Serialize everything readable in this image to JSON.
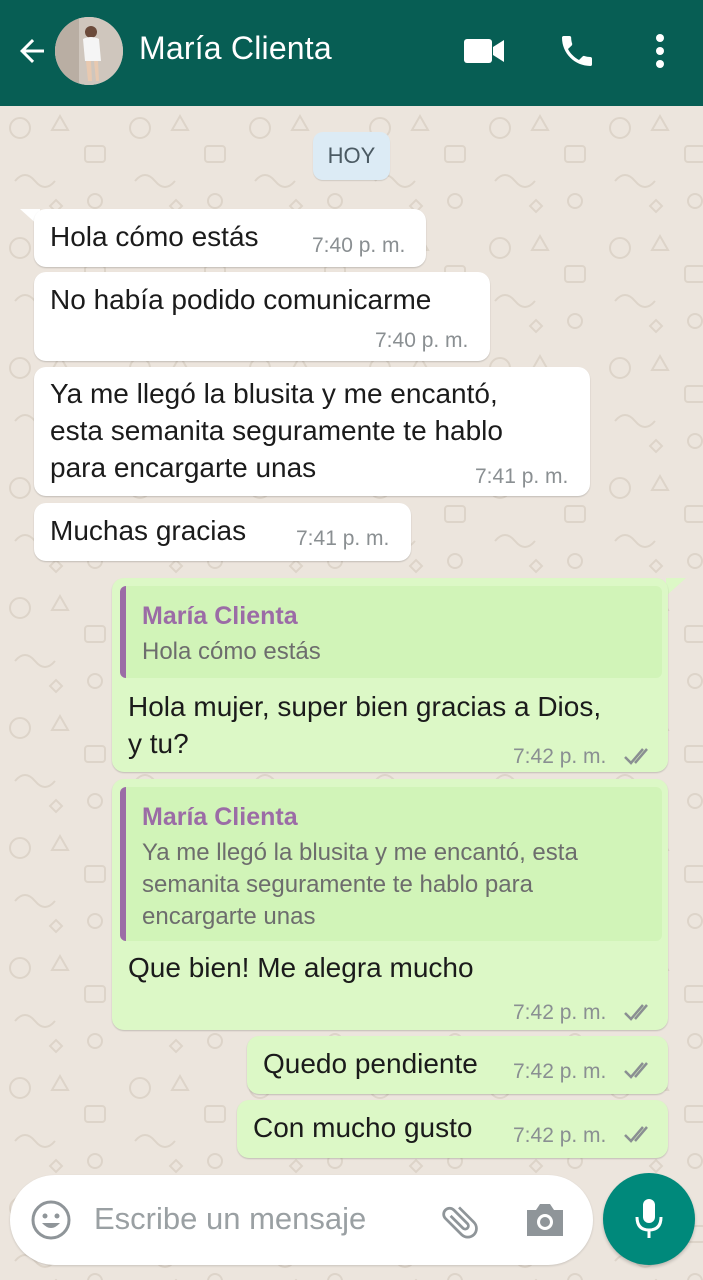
{
  "header": {
    "contact_name": "María Clienta",
    "back_icon": "arrow-left-icon",
    "video_icon": "video-call-icon",
    "phone_icon": "voice-call-icon",
    "menu_icon": "more-vert-icon",
    "background_color": "#075e54"
  },
  "chat": {
    "date_label": "HOY",
    "messages": [
      {
        "direction": "in",
        "text": "Hola cómo estás",
        "time": "7:40 p. m."
      },
      {
        "direction": "in",
        "text": "No había podido comunicarme",
        "time": "7:40 p. m."
      },
      {
        "direction": "in",
        "lines": [
          "Ya me llegó la blusita y me encantó,",
          "esta semanita seguramente te hablo",
          "para encargarte unas"
        ],
        "time": "7:41 p. m."
      },
      {
        "direction": "in",
        "text": "Muchas gracias",
        "time": "7:41 p. m."
      },
      {
        "direction": "out",
        "quote_name": "María Clienta",
        "quote_text": "Hola cómo estás",
        "lines": [
          "Hola mujer, super bien gracias a Dios,",
          "y tu?"
        ],
        "time": "7:42 p. m.",
        "status": "read"
      },
      {
        "direction": "out",
        "quote_name": "María Clienta",
        "quote_lines": [
          "Ya me llegó la blusita y me encantó, esta",
          "semanita seguramente te hablo para",
          "encargarte unas"
        ],
        "text": "Que bien! Me alegra mucho",
        "time": "7:42 p. m.",
        "status": "read"
      },
      {
        "direction": "out",
        "text": "Quedo pendiente",
        "time": "7:42 p. m.",
        "status": "read"
      },
      {
        "direction": "out",
        "text": "Con mucho gusto",
        "time": "7:42 p. m.",
        "status": "read"
      }
    ],
    "incoming_color": "#ffffff",
    "outgoing_color": "#dcf8c6"
  },
  "composer": {
    "placeholder": "Escribe un mensaje",
    "emoji_icon": "emoji-icon",
    "attach_icon": "paperclip-icon",
    "camera_icon": "camera-icon",
    "mic_icon": "microphone-icon",
    "accent_color": "#00897b"
  }
}
